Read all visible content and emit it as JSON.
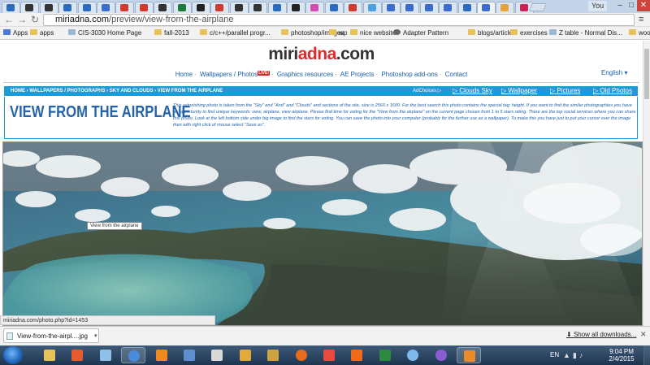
{
  "browser": {
    "url_host": "miriadna.com",
    "url_path": "/preview/view-from-the-airplane",
    "user_label": "You",
    "window_buttons": [
      "–",
      "□",
      "✕"
    ],
    "tab_colors": [
      "#2a6bbf",
      "#333333",
      "#333333",
      "#2a6bbf",
      "#2a6bbf",
      "#3b6ccf",
      "#d23b2b",
      "#d23b2b",
      "#333333",
      "#1e7a3a",
      "#222222",
      "#d23b2b",
      "#333333",
      "#333333",
      "#2a6bbf",
      "#222222",
      "#d64bb1",
      "#2a6bbf",
      "#d23b2b",
      "#4aa0e0",
      "#3b6ccf",
      "#3b6ccf",
      "#3b6ccf",
      "#3b6ccf",
      "#2a6bbf",
      "#3b6ccf",
      "#e8a23b",
      "#cc2255"
    ]
  },
  "bookmarks": [
    {
      "label": "Apps",
      "icon": "apps-grid-icon"
    },
    {
      "label": "apps",
      "icon": "folder-icon"
    },
    {
      "label": "CIS-3030 Home Page",
      "icon": "page-icon"
    },
    {
      "label": "fall-2013",
      "icon": "folder-icon"
    },
    {
      "label": "c/c++/parallel progr...",
      "icon": "folder-icon"
    },
    {
      "label": "photoshop/images",
      "icon": "folder-icon"
    },
    {
      "label": "wp",
      "icon": "folder-icon"
    },
    {
      "label": "nice websites",
      "icon": "folder-icon"
    },
    {
      "label": "Adapter Pattern",
      "icon": "gear-icon"
    },
    {
      "label": "blogs/articles",
      "icon": "folder-icon"
    },
    {
      "label": "exercises",
      "icon": "folder-icon"
    },
    {
      "label": "Z table - Normal Dis...",
      "icon": "page-icon"
    },
    {
      "label": "woocommerce",
      "icon": "folder-icon"
    }
  ],
  "site": {
    "logo_black": "miri",
    "logo_red": "adna",
    "logo_black2": ".com",
    "nav": [
      "Home",
      "Wallpapers / Photos",
      "Graphics resources",
      "AE Projects",
      "Photoshop add-ons",
      "Contact"
    ],
    "live_badge": "LIVE!",
    "language": "English"
  },
  "breadcrumb": {
    "text": "HOME › WALLPAPERS / PHOTOGRAPHS › SKY AND CLOUDS › VIEW FROM THE AIRPLANE",
    "adchoices": "AdChoices ▷",
    "links": [
      "Clouds Sky",
      "Wallpaper",
      "Pictures",
      "Old Photos"
    ]
  },
  "article": {
    "title": "VIEW FROM THE AIRPLANE",
    "description": "This astonishing photo is taken from the \"Sky\" and \"And\" and \"Clouds\" and sections of the site, size is 2560 x 1600. For the best search this photo contains the special tag: height. If you want to find the similar photographies you have an opportunity to find unique keywords: view, airplane, view airplane. Please find time for voting for the \"View from the airplane\" on the current page chosen from 1 to 5 stars rating. There are the top social services where you can share this photo. Look at the left bottom side under big image to find the stars for voting. You can save the photo into your computer (probably for the further use as a wallpaper). To make this you have just to put your cursor over the image then with right click of mouse select \"Save as\"."
  },
  "photo": {
    "tooltip": "View from the airplane"
  },
  "status_url": "miriadna.com/photo.php?id=1453",
  "download": {
    "filename": "View-from-the-airpl....jpg",
    "show_all": "Show all downloads...",
    "close": "✕"
  },
  "taskbar": {
    "lang": "EN",
    "time": "9:04 PM",
    "date": "2/4/2015",
    "apps": [
      {
        "name": "file-explorer-icon",
        "color": "#e7c25a"
      },
      {
        "name": "media-player-icon",
        "color": "#e85b2a"
      },
      {
        "name": "notepad-icon",
        "color": "#8fc0e8"
      },
      {
        "name": "chrome-icon",
        "color": "#4a8bdc"
      },
      {
        "name": "vlc-icon",
        "color": "#f08a1c"
      },
      {
        "name": "remote-desktop-icon",
        "color": "#5d8fd0"
      },
      {
        "name": "paint-icon",
        "color": "#d8d8d8"
      },
      {
        "name": "paint-shop-icon",
        "color": "#e3a93a"
      },
      {
        "name": "media-library-icon",
        "color": "#cfa33f"
      },
      {
        "name": "firefox-icon",
        "color": "#e86b1c"
      },
      {
        "name": "colorful-grid-icon",
        "color": "#e84a3c"
      },
      {
        "name": "xampp-icon",
        "color": "#f26b1d"
      },
      {
        "name": "terminal-icon",
        "color": "#2b8a3e"
      },
      {
        "name": "messenger-icon",
        "color": "#7db8ef"
      },
      {
        "name": "viber-icon",
        "color": "#8a5cd0"
      },
      {
        "name": "sublime-icon",
        "color": "#ea8b2c"
      }
    ]
  }
}
